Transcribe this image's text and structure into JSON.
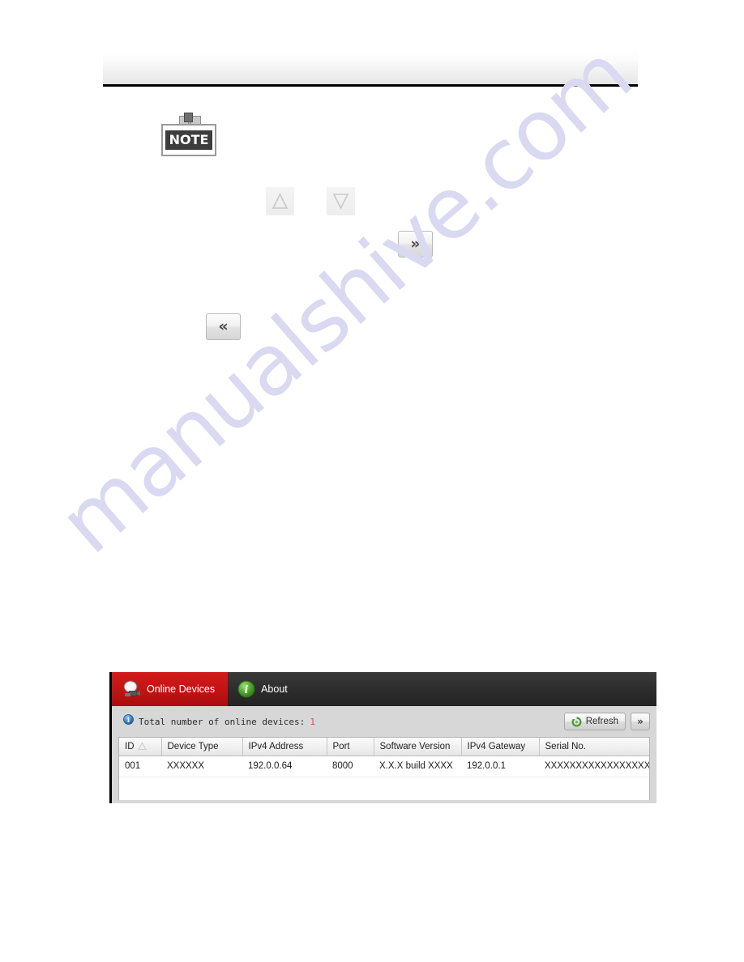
{
  "page": {
    "header_title": "",
    "watermark": "manualshive.com"
  },
  "note": {
    "label": "NOTE",
    "icon": "note-pin-icon"
  },
  "inline_buttons": [
    {
      "name": "sort-up-button",
      "icon": "triangle-up-icon",
      "label": ""
    },
    {
      "name": "sort-down-button",
      "icon": "triangle-down-icon",
      "label": ""
    },
    {
      "name": "expand-right-button",
      "icon": "double-chevron-right-icon",
      "label": "»"
    },
    {
      "name": "collapse-left-button",
      "icon": "double-chevron-left-icon",
      "label": "«"
    }
  ],
  "app": {
    "tabs": [
      {
        "label": "Online Devices",
        "icon": "online-devices-icon",
        "active": true
      },
      {
        "label": "About",
        "icon": "info-icon",
        "active": false
      }
    ],
    "toolbar": {
      "info_icon": "info-icon",
      "status_label": "Total number of online devices:",
      "status_count": "1",
      "refresh_label": "Refresh",
      "refresh_icon": "refresh-icon",
      "expand_label": "»"
    },
    "table": {
      "columns": [
        "ID",
        "Device Type",
        "IPv4 Address",
        "Port",
        "Software Version",
        "IPv4 Gateway",
        "Serial No."
      ],
      "sort_column": "ID",
      "sort_direction": "ascending",
      "rows": [
        {
          "id": "001",
          "device_type": "XXXXXX",
          "ipv4_address": "192.0.0.64",
          "port": "8000",
          "software_version": "X.X.X build XXXX",
          "ipv4_gateway": "192.0.0.1",
          "serial_no": "XXXXXXXXXXXXXXXXXX"
        }
      ]
    }
  },
  "colors": {
    "tab_active": "#c21313",
    "tabstrip": "#2c2c2c",
    "status_count": "#d34d5e",
    "watermark": "#d9d9f2"
  }
}
